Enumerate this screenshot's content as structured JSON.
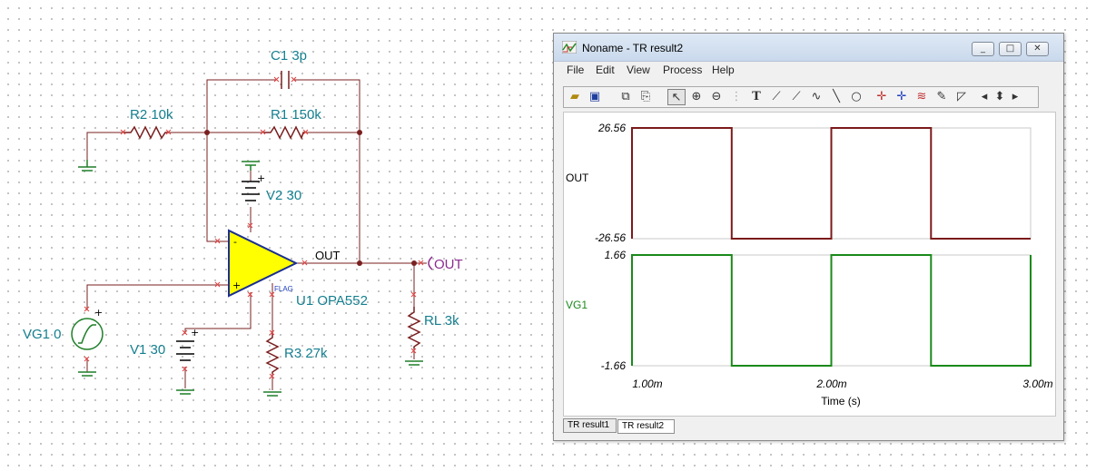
{
  "schematic": {
    "components": {
      "c1": "C1 3p",
      "r2": "R2 10k",
      "r1": "R1 150k",
      "v2": "V2 30",
      "u1": "U1 OPA552",
      "r3": "R3 27k",
      "rl": "RL 3k",
      "vg1": "VG1 0",
      "v1": "V1 30"
    },
    "net_out_label": "OUT",
    "port_out_label": "OUT",
    "flag_label": "FLAG",
    "plus_sign": "+",
    "minus_sign": "-",
    "colors": {
      "wire": "#7a1f1f",
      "ground": "#1e7f28",
      "opamp_fill": "#ffff00",
      "component_text": "#147f8f",
      "port_text": "#8b2b8f"
    }
  },
  "window": {
    "title": "Noname - TR result2",
    "controls": {
      "minimize": "_",
      "maximize": "□",
      "close": "✕"
    },
    "menu": [
      "File",
      "Edit",
      "View",
      "Process",
      "Help"
    ],
    "toolbar_icons": [
      "open-icon",
      "save-icon",
      "copy-icon",
      "paste-icon",
      "pointer-icon",
      "zoom-in-icon",
      "zoom-out-icon",
      "grid-icon",
      "text-icon",
      "cursor-a-icon",
      "cursor-b-icon",
      "curve-icon",
      "line-icon",
      "circle-icon",
      "marker-a-icon",
      "marker-b-icon",
      "wave-icon",
      "pen-icon",
      "step-icon",
      "scroll-left-icon",
      "scroll-updown-icon",
      "scroll-right-icon"
    ],
    "tabs": [
      "TR result1",
      "TR result2"
    ],
    "active_tab": "TR result2"
  },
  "chart_data": [
    {
      "type": "line",
      "series": [
        {
          "name": "OUT",
          "color": "#7b1a1a"
        }
      ],
      "ylim": [
        -26.56,
        26.56
      ],
      "yticks": [
        "26.56",
        "-26.56"
      ],
      "xlim": [
        0.001,
        0.003
      ],
      "x": [
        0.001,
        0.001,
        0.0015,
        0.0015,
        0.002,
        0.002,
        0.0025,
        0.0025,
        0.003
      ],
      "values": [
        -26.56,
        26.56,
        26.56,
        -26.56,
        -26.56,
        26.56,
        26.56,
        -26.56,
        -26.56
      ],
      "ylabel": "OUT"
    },
    {
      "type": "line",
      "series": [
        {
          "name": "VG1",
          "color": "#1a8a1a"
        }
      ],
      "ylim": [
        -1.66,
        1.66
      ],
      "yticks": [
        "1.66",
        "-1.66"
      ],
      "xlim": [
        0.001,
        0.003
      ],
      "x": [
        0.001,
        0.001,
        0.0015,
        0.0015,
        0.002,
        0.002,
        0.0025,
        0.0025,
        0.003,
        0.003
      ],
      "values": [
        -1.66,
        1.66,
        1.66,
        -1.66,
        -1.66,
        1.66,
        1.66,
        -1.66,
        -1.66,
        1.66
      ],
      "ylabel": "VG1",
      "xticks": [
        "1.00m",
        "2.00m",
        "3.00m"
      ],
      "xlabel": "Time (s)"
    }
  ]
}
